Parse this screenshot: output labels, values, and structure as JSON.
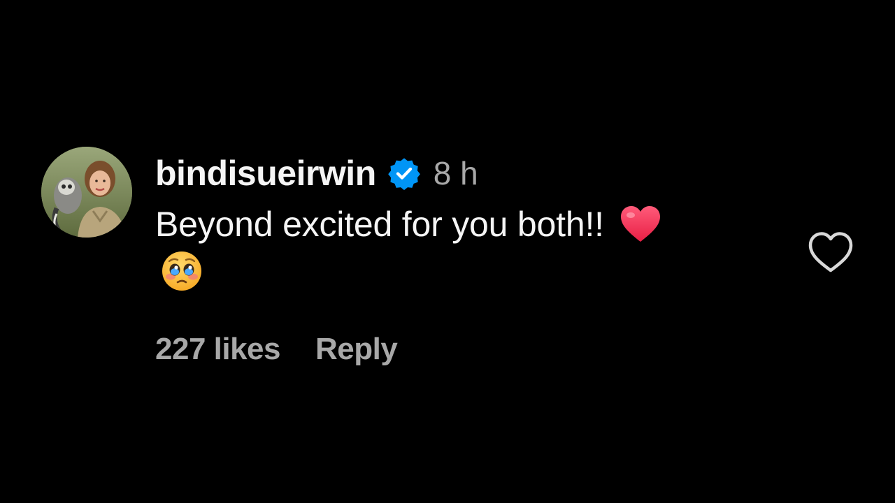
{
  "comment": {
    "username": "bindisueirwin",
    "verified": true,
    "verified_icon": "verified-badge-icon",
    "timestamp": "8 h",
    "text": "Beyond excited for you both!!",
    "emojis": [
      "red-heart-emoji",
      "pleading-face-emoji"
    ],
    "likes_label": "227 likes",
    "reply_label": "Reply",
    "like_icon": "heart-outline-icon"
  },
  "colors": {
    "background": "#000000",
    "primary_text": "#f5f5f5",
    "secondary_text": "#a8a8a8",
    "verified_blue": "#0095f6",
    "heart_red": "#f0314f"
  }
}
